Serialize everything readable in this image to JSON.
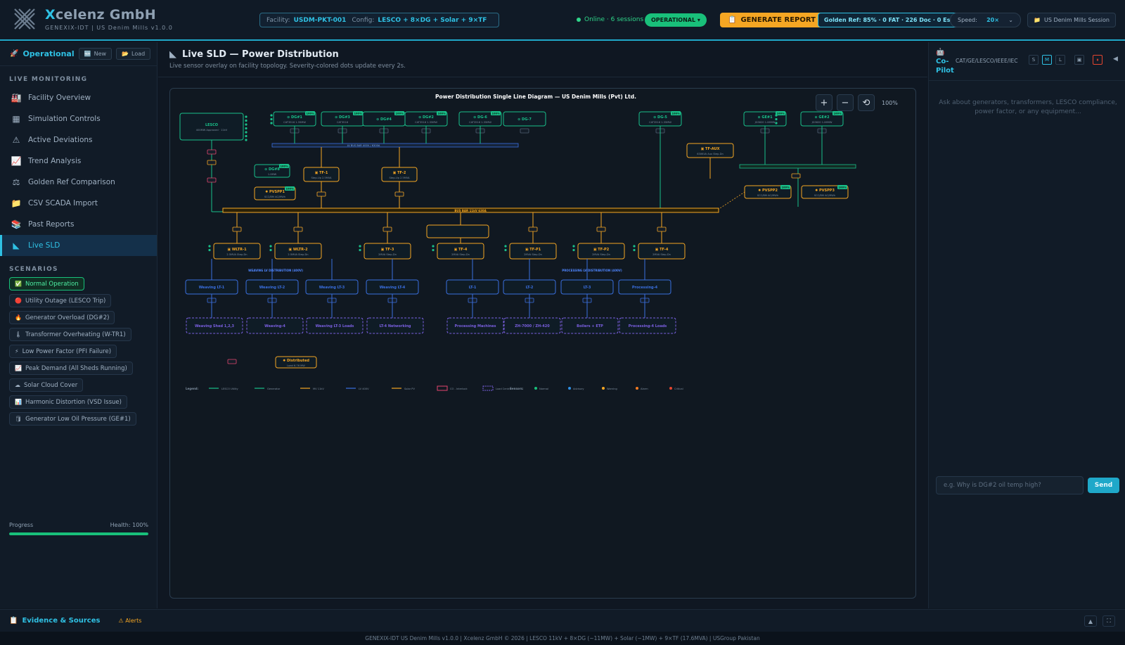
{
  "brand": {
    "name_initial": "X",
    "name_rest": "celenz GmbH",
    "subtitle": "GENEXIX-IDT | US Denim Mills v1.0.0"
  },
  "header": {
    "facility_label": "Facility:",
    "facility_value": "USDM-PKT-001",
    "config_label": "Config:",
    "config_value": "LESCO + 8×DG + Solar + 9×TF",
    "online_text": "Online · 6 sessions",
    "status_pill": "OPERATIONAL ▾",
    "generate_report": "GENERATE REPORT",
    "golden_ref": "Golden Ref: 85% · 0 FAT · 226 Doc · 0 Est",
    "speed_label": "Speed:",
    "speed_value": "20×",
    "session_label": "US Denim Mills Session"
  },
  "sidebar": {
    "mode_title": "Operational",
    "new_label": "New",
    "load_label": "Load",
    "live_monitoring_label": "LIVE MONITORING",
    "nav": [
      {
        "label": "Facility Overview",
        "icon": "🏭"
      },
      {
        "label": "Simulation Controls",
        "icon": "▦"
      },
      {
        "label": "Active Deviations",
        "icon": "⚠"
      },
      {
        "label": "Trend Analysis",
        "icon": "📈"
      },
      {
        "label": "Golden Ref Comparison",
        "icon": "⚖"
      },
      {
        "label": "CSV SCADA Import",
        "icon": "📁"
      },
      {
        "label": "Past Reports",
        "icon": "📚"
      },
      {
        "label": "Live SLD",
        "icon": "◣"
      }
    ],
    "scenarios_label": "SCENARIOS",
    "scenarios": [
      {
        "label": "Normal Operation",
        "icon": "✅"
      },
      {
        "label": "Utility Outage (LESCO Trip)",
        "icon": "🔴"
      },
      {
        "label": "Generator Overload (DG#2)",
        "icon": "🔥"
      },
      {
        "label": "Transformer Overheating (W-TR1)",
        "icon": "🌡"
      },
      {
        "label": "Low Power Factor (PFI Failure)",
        "icon": "⚡"
      },
      {
        "label": "Peak Demand (All Sheds Running)",
        "icon": "📈"
      },
      {
        "label": "Solar Cloud Cover",
        "icon": "☁"
      },
      {
        "label": "Harmonic Distortion (VSD Issue)",
        "icon": "📊"
      },
      {
        "label": "Generator Low Oil Pressure (GE#1)",
        "icon": "🛢"
      }
    ],
    "progress_label": "Progress",
    "health_label": "Health: 100%",
    "progress_value": 1.0
  },
  "main": {
    "title": "Live SLD — Power Distribution",
    "subtitle": "Live sensor overlay on facility topology. Severity-colored dots update every 2s.",
    "zoom_level": "100%"
  },
  "sld": {
    "title": "Power Distribution Single Line Diagram — US Denim Mills (Pvt) Ltd.",
    "source": {
      "name": "LESCO",
      "sub": "400MW Approved · 11kV"
    },
    "generators_top": [
      {
        "name": "DG#1",
        "sub": "CAT3516 1.35MW",
        "pct": "100%"
      },
      {
        "name": "DG#3",
        "sub": "CAT3516",
        "pct": "100%"
      },
      {
        "name": "DG#4",
        "sub": "",
        "pct": "100%"
      },
      {
        "name": "DG#2",
        "sub": "CAT3516 1.35MW",
        "pct": "100%"
      },
      {
        "name": "DG-6",
        "sub": "CAT3516 1.35MW",
        "pct": "100%"
      },
      {
        "name": "DG-7",
        "sub": "",
        "pct": ""
      },
      {
        "name": "DG-5",
        "sub": "CAT3516 1.35MW",
        "pct": "100%"
      },
      {
        "name": "GE#1",
        "sub": "JGS620 1.06MW",
        "pct": "100%"
      },
      {
        "name": "GE#2",
        "sub": "JGS620 1.06MW",
        "pct": "100%"
      }
    ],
    "lv_bus": "LV BUS BAR 400V / 6300A",
    "mv_bus": "BUS BAR 11kV 630A",
    "mid_units": [
      {
        "name": "DG#8",
        "sub": "1.0MW",
        "pct": "100%",
        "kind": "gen"
      },
      {
        "name": "PVSPP1",
        "sub": "SCC/BM AC/MWh",
        "pct": "100%",
        "kind": "solar"
      },
      {
        "name": "TF-1",
        "sub": "Step-Up 2.5MVA",
        "kind": "tf"
      },
      {
        "name": "TF-2",
        "sub": "Step-Up 2.5MVA",
        "kind": "tf"
      },
      {
        "name": "TF-AUX",
        "sub": "630KVA Aux Step-Dn",
        "kind": "tf"
      },
      {
        "name": "PVSPP2",
        "sub": "SCC/BM AC/MWh",
        "pct": "100%",
        "kind": "solar"
      },
      {
        "name": "PVSPP3",
        "sub": "SCC/BM AC/MWh",
        "pct": "100%",
        "kind": "solar"
      }
    ],
    "transformers": [
      {
        "name": "WLTR-1",
        "sub": "2.5MVA Step-Dn"
      },
      {
        "name": "WLTR-2",
        "sub": "2.5MVA Step-Dn"
      },
      {
        "name": "TF-3",
        "sub": "2MVA Step-Dn"
      },
      {
        "name": "TF-4",
        "sub": "2MVA Step-Dn"
      },
      {
        "name": "TF-P1",
        "sub": "2MVA Step-Dn"
      },
      {
        "name": "TF-P2",
        "sub": "2MVA Step-Dn"
      },
      {
        "name": "TF-4",
        "sub": "2MVA Step-Dn"
      }
    ],
    "weaving_label": "WEAVING LV DISTRIBUTION (400V)",
    "processing_label": "PROCESSING LV DISTRIBUTION (400V)",
    "lt_panels": [
      "Weaving LT-1",
      "Weaving LT-2",
      "Weaving LT-3",
      "Weaving LT-4",
      "LT-1",
      "LT-2",
      "LT-3",
      "Processing-4"
    ],
    "loads": [
      "Weaving Shed 1,2,3",
      "Weaving-4",
      "Weaving LT-3 Loads",
      "LT-4 Networking",
      "Processing Machines",
      "ZH-7000 / ZH-420",
      "Boilers + ETP",
      "Processing-4 Loads"
    ],
    "distributed": {
      "name": "Distributed",
      "sub": "Load 6.76 MW"
    },
    "legend_label": "Legend:",
    "legend": [
      "LESCO Utility",
      "Generator",
      "MV 11kV",
      "LV 400V",
      "Solar PV",
      "CO - Interlock",
      "Load Centre"
    ],
    "sensors_label": "Sensors:",
    "sensors": [
      {
        "label": "Normal",
        "color": "#19c07a"
      },
      {
        "label": "Advisory",
        "color": "#2f8fe4"
      },
      {
        "label": "Warning",
        "color": "#f5a623"
      },
      {
        "label": "Alarm",
        "color": "#f57c23"
      },
      {
        "label": "Critical",
        "color": "#e4452f"
      }
    ]
  },
  "copilot": {
    "name_line1": "Co-",
    "name_line2": "Pilot",
    "tags": "CAT/GE/LESCO/IEEE/IEC",
    "size_s": "S",
    "size_m": "M",
    "size_l": "L",
    "hint": "Ask about generators, transformers, LESCO compliance, power factor, or any equipment...",
    "input_placeholder": "e.g. Why is DG#2 oil temp high?",
    "send_label": "Send"
  },
  "evidence": {
    "title": "Evidence & Sources",
    "alerts": "Alerts"
  },
  "footer": "GENEXIX-IDT US Denim Mills v1.0.0 | Xcelenz GmbH © 2026 | LESCO 11kV + 8×DG (~11MW) + Solar (~1MW) + 9×TF (17.6MVA) | USGroup Pakistan",
  "colors": {
    "accent": "#2fc1e4",
    "ok": "#19c07a",
    "warn": "#f5a623",
    "bg": "#0f1722"
  }
}
